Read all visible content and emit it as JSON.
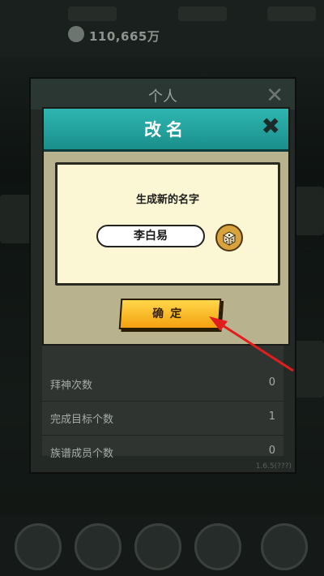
{
  "header": {
    "coins": "110,665万"
  },
  "personal_panel": {
    "title": "个人",
    "stats": [
      {
        "label": "拜神次数",
        "value": "0"
      },
      {
        "label": "完成目标个数",
        "value": "1"
      },
      {
        "label": "族谱成员个数",
        "value": "0"
      }
    ],
    "footer": "1.6.5(???)"
  },
  "rename_dialog": {
    "title": "改名",
    "generate_label": "生成新的名字",
    "name_value": "李白易",
    "confirm_label": "确定"
  },
  "colors": {
    "dialog_header": "#23a5a1",
    "confirm_button": "#f8c22c",
    "annotation_arrow": "#e11d1d"
  }
}
